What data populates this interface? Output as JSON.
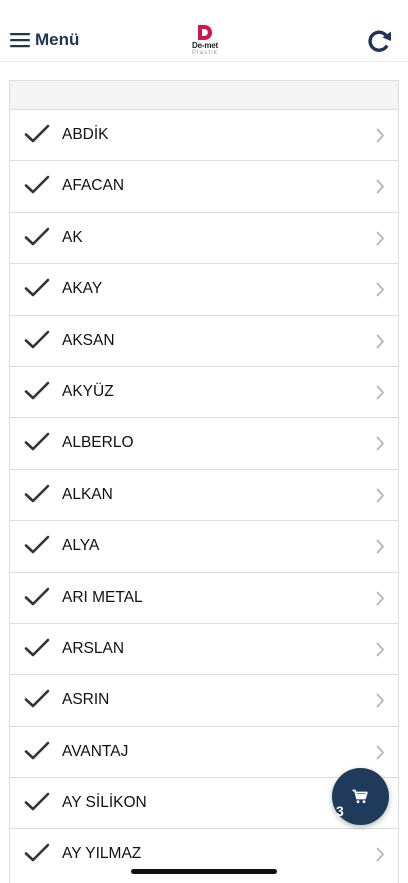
{
  "header": {
    "menu_label": "Menü",
    "logo_name": "De-met",
    "logo_sub": "Plastik"
  },
  "brands": [
    {
      "label": "ABDİK"
    },
    {
      "label": "AFACAN"
    },
    {
      "label": "AK"
    },
    {
      "label": "AKAY"
    },
    {
      "label": "AKSAN"
    },
    {
      "label": "AKYÜZ"
    },
    {
      "label": "ALBERLO"
    },
    {
      "label": "ALKAN"
    },
    {
      "label": "ALYA"
    },
    {
      "label": "ARI METAL"
    },
    {
      "label": "ARSLAN"
    },
    {
      "label": "ASRIN"
    },
    {
      "label": "AVANTAJ"
    },
    {
      "label": "AY SİLİKON"
    },
    {
      "label": "AY YILMAZ"
    }
  ],
  "cart": {
    "count": "3"
  },
  "colors": {
    "brand_navy": "#1f3553",
    "logo_red": "#d2164a",
    "cart_bg": "#1f3a5a"
  }
}
